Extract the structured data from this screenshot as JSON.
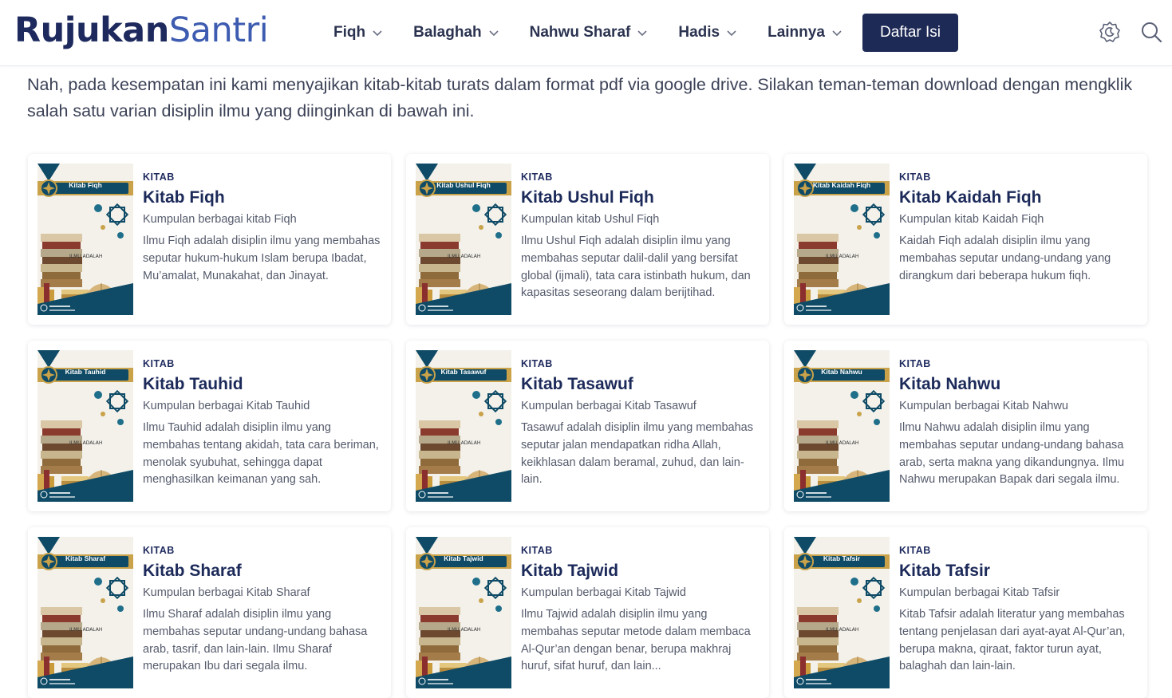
{
  "header": {
    "logo_part1": "Rujukan",
    "logo_part2": "Santri",
    "nav": [
      {
        "label": "Fiqh"
      },
      {
        "label": "Balaghah"
      },
      {
        "label": "Nahwu Sharaf"
      },
      {
        "label": "Hadis"
      },
      {
        "label": "Lainnya"
      }
    ],
    "daftar_label": "Daftar Isi",
    "icons": [
      "theme-toggle-icon",
      "search-icon"
    ]
  },
  "intro": "Nah, pada kesempatan ini kami menyajikan kitab-kitab turats dalam format pdf via google drive. Silakan teman-teman download dengan mengklik salah satu varian disiplin ilmu yang diinginkan di bawah ini.",
  "colors": {
    "navy": "#1e2a56",
    "gold": "#c9a24a",
    "teal": "#0f4b66"
  },
  "cards": [
    {
      "kicker": "KITAB",
      "title": "Kitab Fiqh",
      "subtitle": "Kumpulan berbagai kitab Fiqh",
      "desc": "Ilmu Fiqh adalah disiplin ilmu yang membahas seputar hukum-hukum Islam berupa Ibadat, Mu’amalat, Munakahat, dan Jinayat.",
      "thumb_label": "Kitab Fiqh"
    },
    {
      "kicker": "KITAB",
      "title": "Kitab Ushul Fiqh",
      "subtitle": "Kumpulan kitab Ushul Fiqh",
      "desc": "Ilmu Ushul Fiqh adalah disiplin ilmu yang membahas seputar dalil-dalil yang bersifat global (ijmali), tata cara istinbath hukum, dan kapasitas seseorang dalam berijtihad.",
      "thumb_label": "Kitab Ushul Fiqh"
    },
    {
      "kicker": "KITAB",
      "title": "Kitab Kaidah Fiqh",
      "subtitle": "Kumpulan kitab Kaidah Fiqh",
      "desc": "Kaidah Fiqh adalah disiplin ilmu yang membahas seputar undang-undang yang dirangkum dari beberapa hukum fiqh.",
      "thumb_label": "Kitab Kaidah Fiqh"
    },
    {
      "kicker": "KITAB",
      "title": "Kitab Tauhid",
      "subtitle": "Kumpulan berbagai Kitab Tauhid",
      "desc": "Ilmu Tauhid adalah disiplin ilmu yang membahas tentang akidah, tata cara beriman, menolak syubuhat, sehingga dapat menghasilkan keimanan yang sah.",
      "thumb_label": "Kitab Tauhid"
    },
    {
      "kicker": "KITAB",
      "title": "Kitab Tasawuf",
      "subtitle": "Kumpulan berbagai Kitab Tasawuf",
      "desc": "Tasawuf adalah disiplin ilmu yang membahas seputar jalan mendapatkan ridha Allah, keikhlasan dalam beramal, zuhud, dan lain-lain.",
      "thumb_label": "Kitab Tasawuf"
    },
    {
      "kicker": "KITAB",
      "title": "Kitab Nahwu",
      "subtitle": "Kumpulan berbagai Kitab Nahwu",
      "desc": "Ilmu Nahwu adalah disiplin ilmu yang membahas seputar undang-undang bahasa arab, serta makna yang dikandungnya. Ilmu Nahwu merupakan Bapak dari segala ilmu.",
      "thumb_label": "Kitab Nahwu"
    },
    {
      "kicker": "KITAB",
      "title": "Kitab Sharaf",
      "subtitle": "Kumpulan berbagai Kitab Sharaf",
      "desc": "Ilmu Sharaf adalah disiplin ilmu yang membahas seputar undang-undang bahasa arab, tasrif, dan lain-lain. Ilmu Sharaf merupakan Ibu dari segala ilmu.",
      "thumb_label": "Kitab Sharaf"
    },
    {
      "kicker": "KITAB",
      "title": "Kitab Tajwid",
      "subtitle": "Kumpulan berbagai Kitab Tajwid",
      "desc": "Ilmu Tajwid adalah disiplin ilmu yang membahas seputar metode dalam membaca Al-Qur’an dengan benar, berupa makhraj huruf, sifat huruf, dan lain...",
      "thumb_label": "Kitab Tajwid"
    },
    {
      "kicker": "KITAB",
      "title": "Kitab Tafsir",
      "subtitle": "Kumpulan berbagai Kitab Tafsir",
      "desc": "Kitab Tafsir adalah literatur yang membahas tentang penjelasan dari ayat-ayat Al-Qur’an, berupa makna, qiraat, faktor turun ayat, balaghah dan lain-lain.",
      "thumb_label": "Kitab Tafsir"
    }
  ]
}
